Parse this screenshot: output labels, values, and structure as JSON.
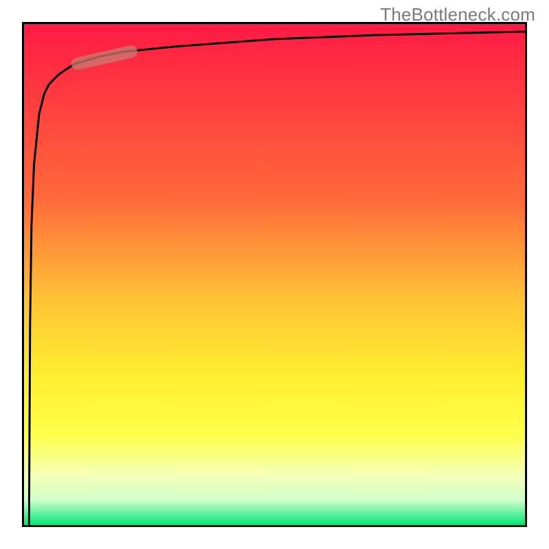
{
  "watermark": "TheBottleneck.com",
  "colors": {
    "top": "#ff1a44",
    "p35": "#ff6a3a",
    "p55": "#ffc236",
    "p70": "#ffee2e",
    "p82": "#ffff4a",
    "p90": "#f4ffb6",
    "p95": "#d0ffcc",
    "bottom": "#00e676",
    "highlight": "#c97b71"
  },
  "chart_data": {
    "type": "line",
    "title": "",
    "xlabel": "",
    "ylabel": "",
    "xlim": [
      0,
      100
    ],
    "ylim": [
      0,
      100
    ],
    "series": [
      {
        "name": "curve",
        "x": [
          1,
          1.2,
          1.5,
          2,
          3,
          4,
          5,
          7,
          10,
          15,
          20,
          30,
          50,
          70,
          100
        ],
        "y": [
          0,
          40,
          60,
          72,
          82,
          86,
          88,
          90,
          92,
          93.5,
          94.5,
          95.5,
          97,
          97.8,
          98.5
        ]
      }
    ],
    "highlight_segment": {
      "x_start": 10,
      "x_end": 22,
      "note": "shaded pill marker on curve"
    }
  }
}
